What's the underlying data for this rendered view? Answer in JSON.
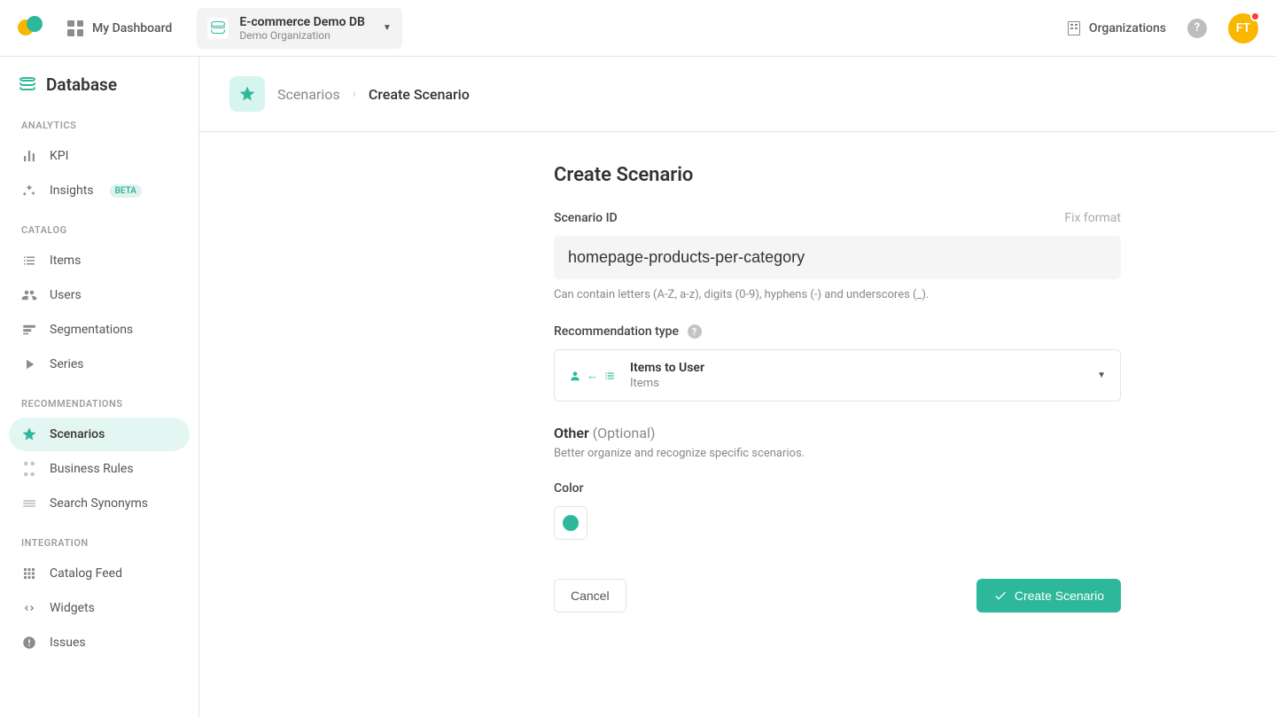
{
  "topbar": {
    "dashboard": "My Dashboard",
    "db_name": "E-commerce Demo DB",
    "org_name": "Demo Organization",
    "organizations": "Organizations",
    "avatar_initials": "FT"
  },
  "sidebar": {
    "title": "Database",
    "sections": {
      "analytics": "ANALYTICS",
      "catalog": "CATALOG",
      "recommendations": "RECOMMENDATIONS",
      "integration": "INTEGRATION"
    },
    "items": {
      "kpi": "KPI",
      "insights": "Insights",
      "insights_badge": "BETA",
      "items": "Items",
      "users": "Users",
      "segmentations": "Segmentations",
      "series": "Series",
      "scenarios": "Scenarios",
      "business_rules": "Business Rules",
      "search_synonyms": "Search Synonyms",
      "catalog_feed": "Catalog Feed",
      "widgets": "Widgets",
      "issues": "Issues"
    }
  },
  "breadcrumb": {
    "parent": "Scenarios",
    "current": "Create Scenario"
  },
  "form": {
    "title": "Create Scenario",
    "scenario_id_label": "Scenario ID",
    "fix_format": "Fix format",
    "scenario_id_value": "homepage-products-per-category",
    "scenario_id_hint": "Can contain letters (A-Z, a-z), digits (0-9), hyphens (-) and underscores (_).",
    "rec_type_label": "Recommendation type",
    "rec_selected_title": "Items to User",
    "rec_selected_sub": "Items",
    "other_label": "Other",
    "other_optional": "(Optional)",
    "other_sub": "Better organize and recognize specific scenarios.",
    "color_label": "Color",
    "color_value": "#2eb89b",
    "cancel": "Cancel",
    "submit": "Create Scenario"
  }
}
